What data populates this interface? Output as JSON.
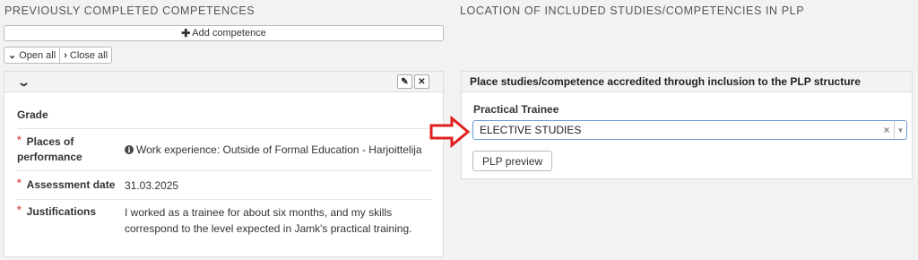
{
  "left_section": {
    "title": "PREVIOUSLY COMPLETED COMPETENCES",
    "add_label": "Add competence",
    "open_all": "Open all",
    "close_all": "Close all",
    "card": {
      "fields": [
        {
          "label": "Grade",
          "required": false,
          "value": ""
        },
        {
          "label": "Places of performance",
          "required": true,
          "value": "Work experience: Outside of Formal Education - Harjoittelija"
        },
        {
          "label": "Assessment date",
          "required": true,
          "value": "31.03.2025"
        },
        {
          "label": "Justifications",
          "required": true,
          "value": "I worked as a trainee for about six months, and my skills correspond to the level expected in Jamk's practical training."
        }
      ]
    }
  },
  "right_section": {
    "title": "LOCATION OF INCLUDED STUDIES/COMPETENCIES IN PLP",
    "card_header": "Place studies/competence accredited through inclusion to the PLP structure",
    "field_label": "Practical Trainee",
    "selected_value": "ELECTIVE STUDIES",
    "preview_button": "PLP preview"
  },
  "icons": {
    "edit": "pencil-icon",
    "delete": "close-icon",
    "collapse": "chevron-down-icon",
    "info": "info-icon",
    "annotation": "red-arrow"
  },
  "colors": {
    "required": "#d9534f",
    "select_border": "#6a9ad3",
    "annotation_arrow": "#e02020"
  }
}
